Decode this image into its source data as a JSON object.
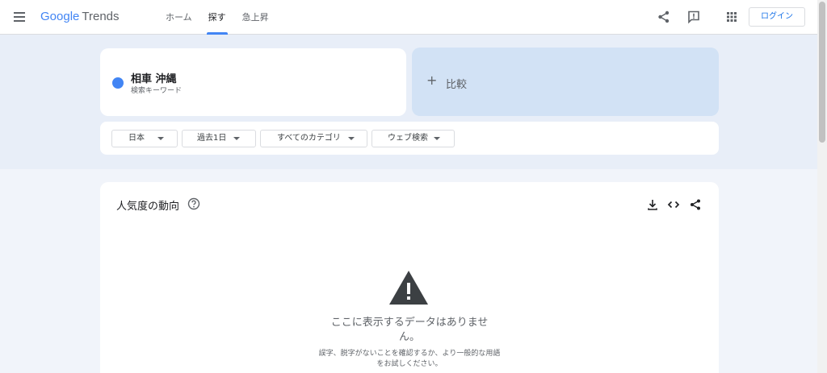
{
  "header": {
    "logo_google": "Google",
    "logo_trends": "Trends",
    "nav": [
      {
        "label": "ホーム"
      },
      {
        "label": "探す"
      },
      {
        "label": "急上昇"
      }
    ],
    "login_label": "ログイン",
    "icons": [
      "menu-icon",
      "share-icon",
      "feedback-icon",
      "apps-icon"
    ]
  },
  "search": {
    "term": "相車 沖縄",
    "term_sub": "検索キーワード",
    "term_color": "#4285f4",
    "compare_plus": "+",
    "compare_label": "比較"
  },
  "filters": [
    {
      "label": "日本"
    },
    {
      "label": "過去1日"
    },
    {
      "label": "すべてのカテゴリ"
    },
    {
      "label": "ウェブ検索"
    }
  ],
  "interest": {
    "title": "人気度の動向",
    "empty_message": "ここに表示するデータはありません。",
    "empty_hint": "誤字、脱字がないことを確認するか、より一般的な用語をお試しください。",
    "icons": [
      "help-icon",
      "download-icon",
      "embed-icon",
      "share-icon"
    ]
  },
  "colors": {
    "accent": "#4285f4",
    "link": "#1a73e8",
    "compare_bg": "#d2e2f5",
    "page_bg": "#e8eef8"
  }
}
